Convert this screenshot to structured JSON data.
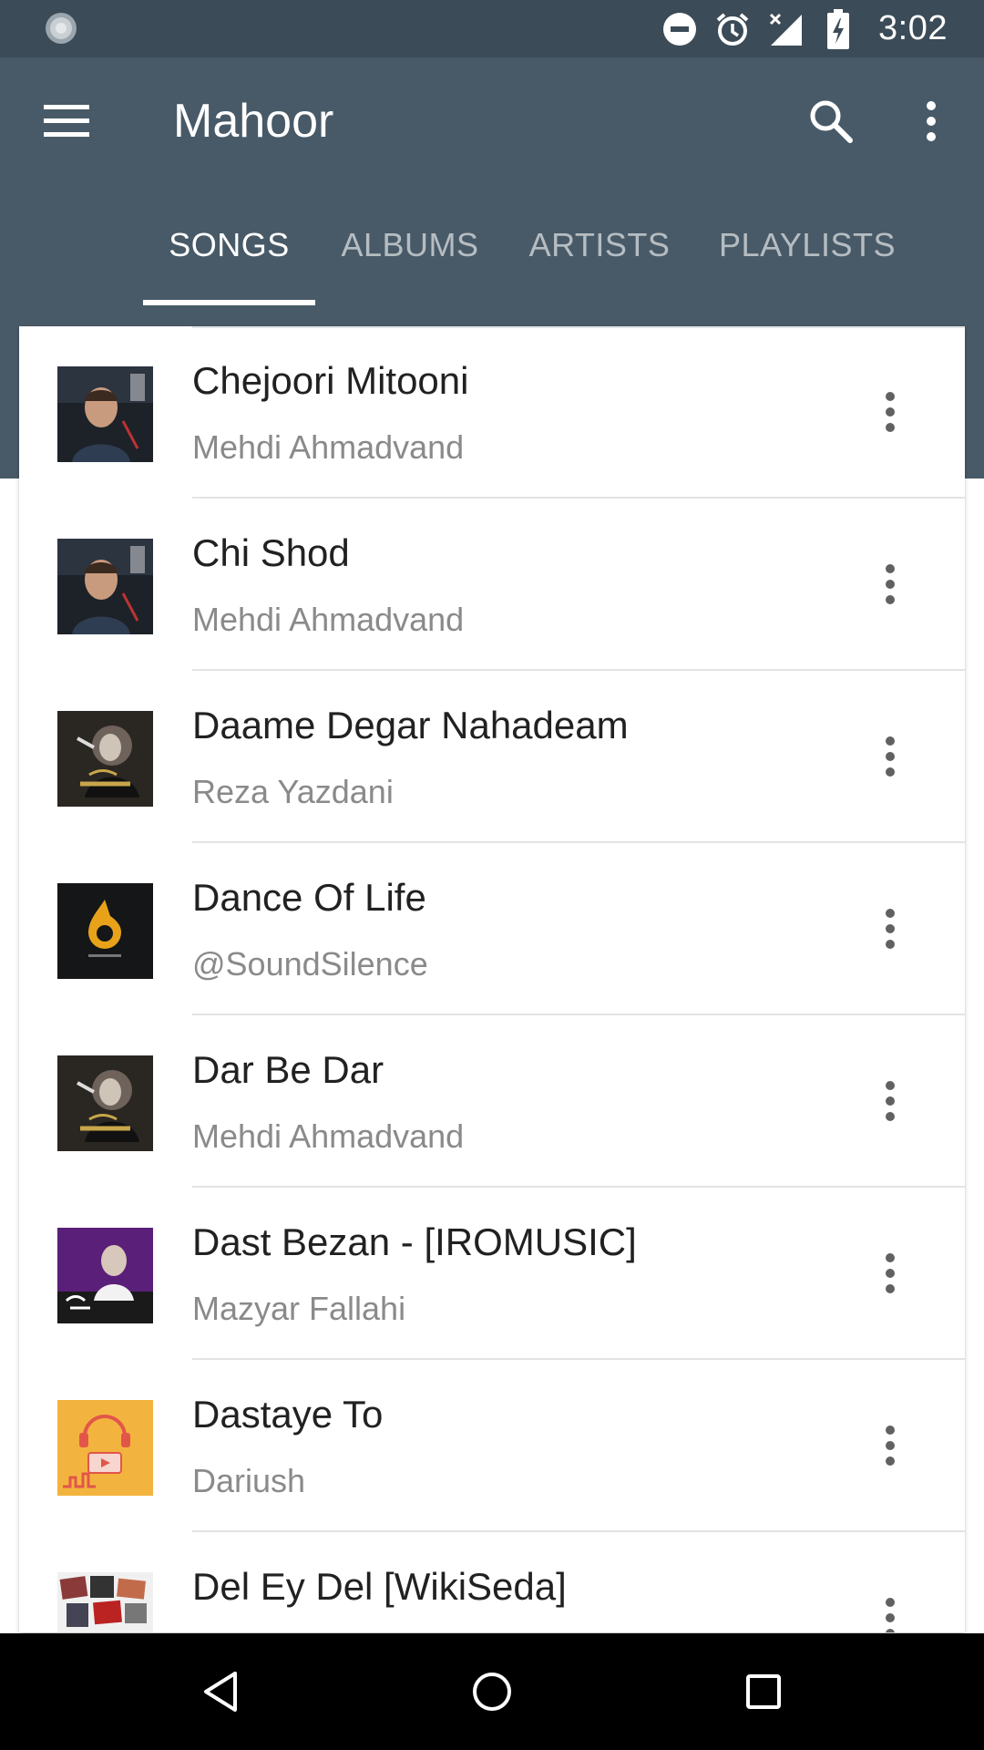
{
  "status_bar": {
    "time": "3:02",
    "icons": [
      "sync-icon",
      "do-not-disturb-icon",
      "alarm-icon",
      "no-signal-icon",
      "battery-charging-icon"
    ]
  },
  "app_bar": {
    "title": "Mahoor",
    "icons": [
      "menu-icon",
      "search-icon",
      "overflow-menu-icon"
    ]
  },
  "tabs": [
    {
      "label": "SONGS",
      "active": true
    },
    {
      "label": "ALBUMS",
      "active": false
    },
    {
      "label": "ARTISTS",
      "active": false
    },
    {
      "label": "PLAYLISTS",
      "active": false
    }
  ],
  "songs": [
    {
      "title": "Chejoori Mitooni",
      "artist": "Mehdi Ahmadvand",
      "art": "album-art-portrait-icon"
    },
    {
      "title": "Chi Shod",
      "artist": "Mehdi Ahmadvand",
      "art": "album-art-portrait-icon"
    },
    {
      "title": "Daame Degar Nahadeam",
      "artist": "Reza Yazdani",
      "art": "album-art-singer-icon"
    },
    {
      "title": "Dance Of Life",
      "artist": "@SoundSilence",
      "art": "album-art-note-icon"
    },
    {
      "title": "Dar Be Dar",
      "artist": "Mehdi Ahmadvand",
      "art": "album-art-singer-icon"
    },
    {
      "title": "Dast Bezan - [IROMUSIC]",
      "artist": "Mazyar Fallahi",
      "art": "album-art-purple-icon"
    },
    {
      "title": "Dastaye To",
      "artist": "Dariush",
      "art": "album-art-headphones-icon"
    },
    {
      "title": "Del Ey Del [WikiSeda]",
      "artist": "",
      "art": "album-art-collage-icon"
    }
  ],
  "nav_bar": {
    "icons": [
      "back-icon",
      "home-icon",
      "recents-icon"
    ]
  },
  "colors": {
    "primary": "#485a67",
    "status_bar": "#3b4b57",
    "title_text": "#212121",
    "secondary_text": "#8a8a8a"
  }
}
